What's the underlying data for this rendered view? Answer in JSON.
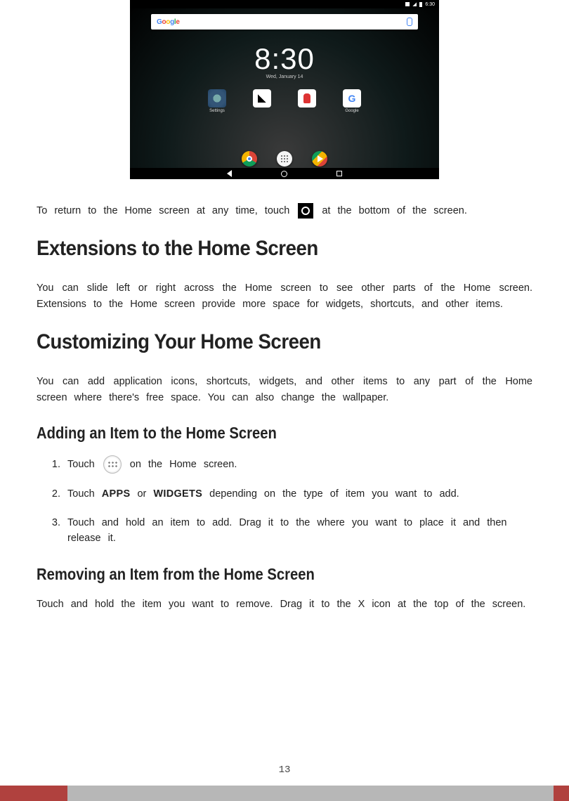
{
  "device": {
    "status_time": "6:30",
    "clock_time": "8:30",
    "clock_date": "Wed, January 14",
    "apps": [
      {
        "label": "Settings"
      },
      {
        "label": ""
      },
      {
        "label": ""
      },
      {
        "label": "Google"
      }
    ]
  },
  "p1_a": "To return to the Home screen at any time, touch",
  "p1_b": " at the bottom of the screen.",
  "h1": "Extensions to the Home Screen",
  "p2": "You can slide left or right across the Home screen to see other parts of the Home screen. Extensions to the Home screen provide more space for widgets, shortcuts, and other items.",
  "h2": "Customizing Your Home Screen",
  "p3": "You can add application icons, shortcuts, widgets, and other items to any part of the Home screen where there's free space. You can also change the wallpaper.",
  "h3": "Adding an Item to the Home Screen",
  "steps": {
    "s1a": "Touch ",
    "s1b": " on the Home screen.",
    "s2a": "Touch ",
    "s2b": " or ",
    "s2c": " depending on the type of item you want to add.",
    "s2_apps": "APPS",
    "s2_widgets": "WIDGETS",
    "s3": "Touch and hold an item to add. Drag it to the where you want to place it and then release it."
  },
  "h4": "Removing an Item from the Home Screen",
  "p4": "Touch and hold the item you want to remove. Drag it to the X icon at the top of the screen.",
  "page_number": "13"
}
